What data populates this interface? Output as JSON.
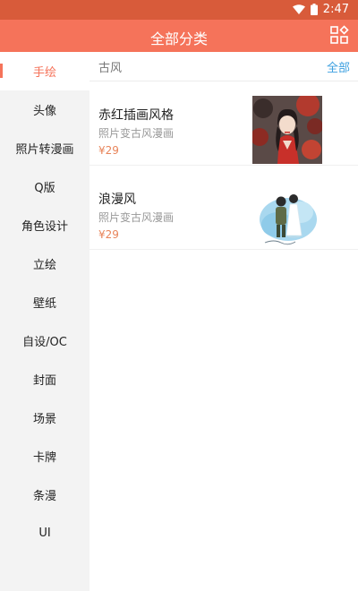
{
  "status_bar": {
    "time": "2:47"
  },
  "app_bar": {
    "title": "全部分类"
  },
  "sidebar": {
    "items": [
      {
        "label": "手绘",
        "active": true
      },
      {
        "label": "头像"
      },
      {
        "label": "照片转漫画"
      },
      {
        "label": "Q版"
      },
      {
        "label": "角色设计"
      },
      {
        "label": "立绘"
      },
      {
        "label": "壁纸"
      },
      {
        "label": "自设/OC"
      },
      {
        "label": "封面"
      },
      {
        "label": "场景"
      },
      {
        "label": "卡牌"
      },
      {
        "label": "条漫"
      },
      {
        "label": "UI"
      }
    ]
  },
  "section": {
    "title": "古风",
    "all_label": "全部"
  },
  "products": [
    {
      "name": "赤红插画风格",
      "subtitle": "照片变古风漫画",
      "price": "¥29"
    },
    {
      "name": "浪漫风",
      "subtitle": "照片变古风漫画",
      "price": "¥29"
    }
  ],
  "colors": {
    "accent": "#f5735a",
    "status_bar": "#d85b3a",
    "link": "#3ca0e0",
    "price": "#e8845a"
  }
}
